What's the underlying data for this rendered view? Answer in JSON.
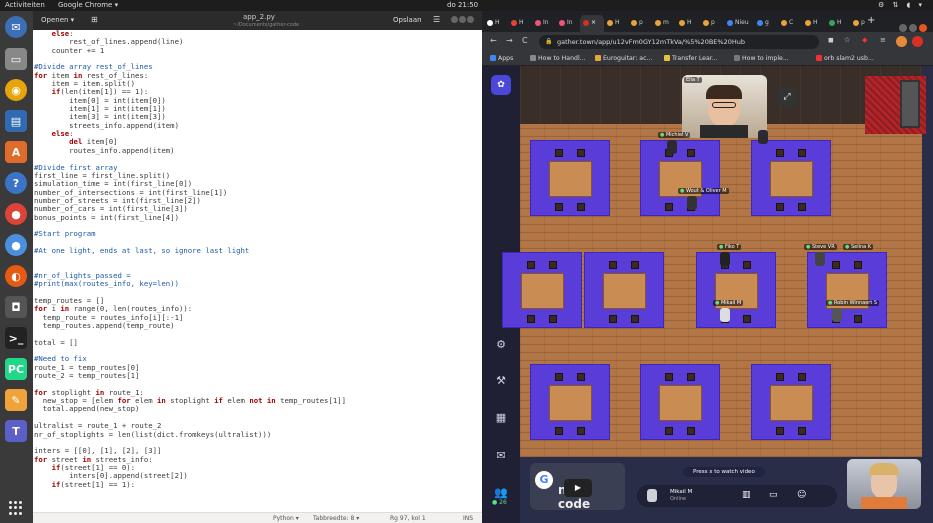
{
  "topbar": {
    "activities": "Activiteiten",
    "app": "Google Chrome ▾",
    "clock": "do 21:50",
    "tray": "⚙ ⇅ ◖ ▾"
  },
  "editor": {
    "open_label": "Openen ▾",
    "filename": "app_2.py",
    "filepath": "~/Documents/gather-code",
    "save_label": "Opslaan",
    "menu_icon": "☰",
    "status": {
      "lang": "Python ▾",
      "tab": "Tabbreedte: 8 ▾",
      "pos": "Rg 97, kol 1",
      "mode": "INS"
    },
    "lines": [
      "    else:",
      "        rest_of_lines.append(line)",
      "    counter += 1",
      "",
      "#Divide array rest_of_lines",
      "for item in rest_of_lines:",
      "    item = item.split()",
      "    if(len(item[1]) == 1):",
      "        item[0] = int(item[0])",
      "        item[1] = int(item[1])",
      "        item[3] = int(item[3])",
      "        streets_info.append(item)",
      "    else:",
      "        del item[0]",
      "        routes_info.append(item)",
      "",
      "#Divide first array",
      "first_line = first_line.split()",
      "simulation_time = int(first_line[0])",
      "number_of_intersections = int(first_line[1])",
      "number_of_streets = int(first_line[2])",
      "number_of_cars = int(first_line[3])",
      "bonus_points = int(first_line[4])",
      "",
      "#Start program",
      "",
      "#At one light, ends at last, so ignore last light",
      "",
      "",
      "#nr_of_lights_passed =",
      "#print(max(routes_info, key=len))",
      "",
      "temp_routes = []",
      "for i in range(0, len(routes_info)):",
      "  temp_route = routes_info[i][:-1]",
      "  temp_routes.append(temp_route)",
      "",
      "total = []",
      "",
      "#Need to fix",
      "route_1 = temp_routes[0]",
      "route_2 = temp_routes[1]",
      "",
      "for stoplight in route_1:",
      "  new_stop = [elem for elem in stoplight if elem not in temp_routes[1]]",
      "  total.append(new_stop)",
      "",
      "ultralist = route_1 + route_2",
      "nr_of_stoplights = len(list(dict.fromkeys(ultralist)))",
      "",
      "inters = [[0], [1], [2], [3]]",
      "for street in streets_info:",
      "    if(street[1] == 0):",
      "        inters[0].append(street[2])",
      "    if(street[1] == 1):"
    ]
  },
  "chrome": {
    "tabs": [
      "H",
      "H",
      "In",
      "In",
      "×",
      "H",
      "p",
      "m",
      "H",
      "p",
      "Nieu",
      "g",
      "C",
      "H",
      "H",
      "p"
    ],
    "url": "gather.town/app/u12vFm0GY12mTkVa/%5%20BE%20Hub",
    "bookmarks": [
      "Apps",
      "How to Handl...",
      "Euroguitar: ac...",
      "Transfer Lear...",
      "How to imple...",
      "orb slam2 usb..."
    ]
  },
  "gather": {
    "names": {
      "top_video": "Ella T",
      "michiel": "Michiel V",
      "wout": "Wout & Oliver M",
      "fiko": "Fiko T",
      "steve": "Steve VR",
      "selina": "Selina K",
      "mikail_map": "Mikail M",
      "robin": "Robin Winnaert S"
    },
    "press_tip": "Press x to watch video",
    "yt_title": "nash code",
    "user": {
      "name": "Mikail M",
      "status": "Online"
    },
    "participants": "26",
    "colors": {
      "pod": "#5a3cd8",
      "floor": "#b17546",
      "accent": "#4b47d8"
    }
  }
}
